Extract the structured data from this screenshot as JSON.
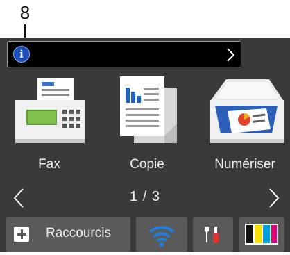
{
  "callout": {
    "number": "8"
  },
  "info_bar": {
    "message": ""
  },
  "apps": [
    {
      "label": "Fax",
      "icon": "fax-machine-icon"
    },
    {
      "label": "Copie",
      "icon": "copy-documents-icon"
    },
    {
      "label": "Numériser",
      "icon": "scanner-icon"
    }
  ],
  "pager": {
    "page_indicator": "1 / 3"
  },
  "bottom_bar": {
    "shortcuts_label": "Raccourcis",
    "wifi_icon": "wifi-icon",
    "tools_icon": "settings-tools-icon",
    "ink_icon": "ink-levels-icon"
  },
  "colors": {
    "screen_bg": "#3a3a3a",
    "button_bg": "#5a5a5a",
    "info_blue": "#1b4fb8",
    "wifi_blue": "#1e7fe0",
    "ink_black": "#111111",
    "ink_yellow": "#f7e000",
    "ink_cyan": "#00a0e0",
    "ink_magenta": "#e0007a"
  }
}
